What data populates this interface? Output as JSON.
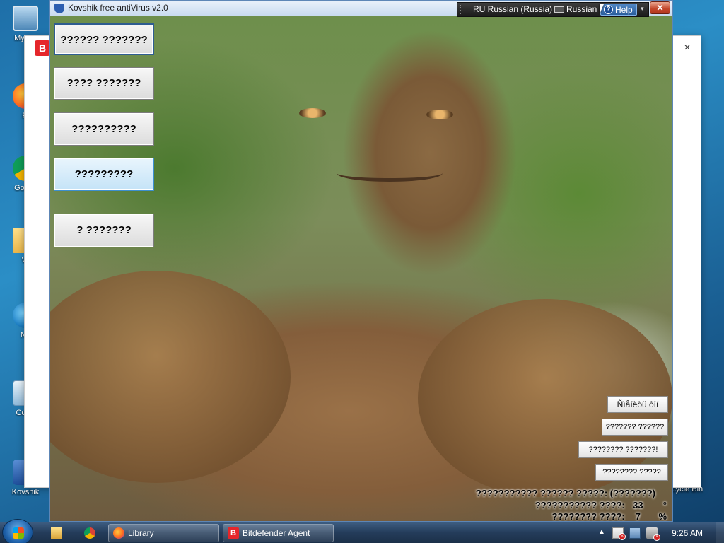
{
  "desktop": {
    "icons": [
      {
        "label": "My Co"
      },
      {
        "label": "Fi"
      },
      {
        "label": "Go Ch"
      },
      {
        "label": "W"
      },
      {
        "label": "Ne"
      },
      {
        "label": "Contr"
      },
      {
        "label": "Kovshik"
      }
    ],
    "recycle_bin_label": "ecycle Bin"
  },
  "background_window": {
    "logo_letter": "B",
    "close_glyph": "×"
  },
  "kovshik": {
    "title": "Kovshik free antiVirus v2.0",
    "close_glyph": "✕",
    "menu": [
      {
        "label": "?????? ???????"
      },
      {
        "label": "???? ???????"
      },
      {
        "label": "??????????"
      },
      {
        "label": "?????????"
      },
      {
        "label": "? ???????"
      }
    ],
    "side_buttons": [
      {
        "label": "Ñìåíèòü ôîí"
      },
      {
        "label": "??????? ??????"
      },
      {
        "label": "???????? ???????!"
      },
      {
        "label": "???????? ?????"
      }
    ],
    "status": [
      {
        "text": "??????????? ?????? ?????: (???????)",
        "value": "",
        "unit": ""
      },
      {
        "text": "??????????? ????:",
        "value": "33",
        "unit": "°"
      },
      {
        "text": "???????? ????:",
        "value": "7",
        "unit": "%"
      }
    ]
  },
  "language_bar": {
    "current_language": "RU Russian (Russia)",
    "keyboard_label": "Russian",
    "help_label": "Help",
    "help_icon": "?",
    "menu_arrow": "▾"
  },
  "taskbar": {
    "tasks": [
      {
        "label": "Library",
        "icon": "firefox-icon"
      },
      {
        "label": "Bitdefender Agent",
        "icon": "bitdefender-icon",
        "icon_letter": "B"
      }
    ],
    "tray_arrow": "▲",
    "clock": "9:26 AM"
  }
}
